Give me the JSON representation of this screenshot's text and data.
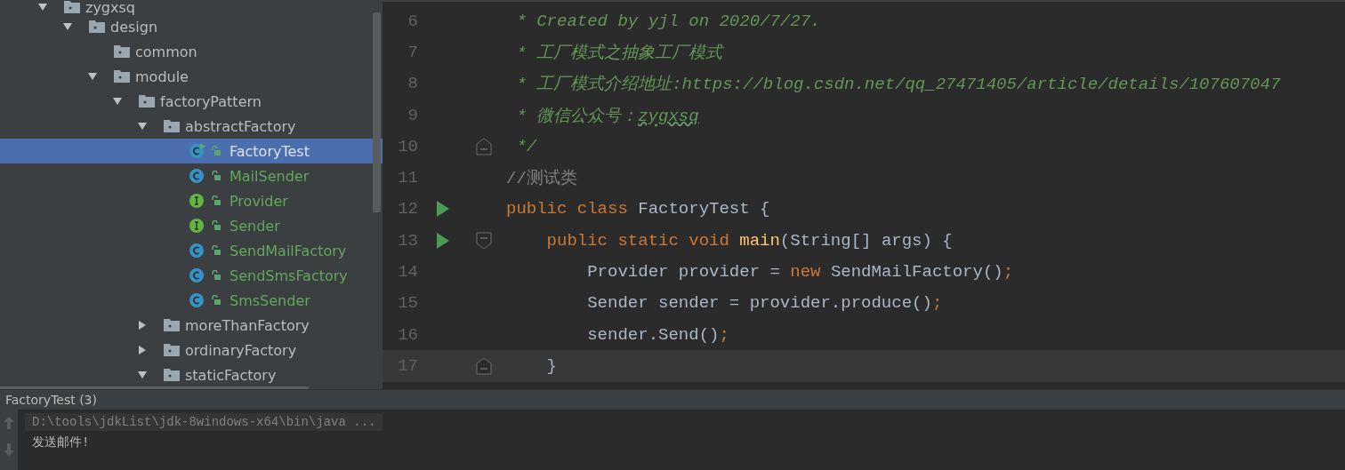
{
  "project_tree": [
    {
      "label": "zygxsq",
      "kind": "folder",
      "expanded": true,
      "selected": false,
      "children": [
        {
          "label": "design",
          "kind": "folder",
          "expanded": true,
          "selected": false,
          "children": [
            {
              "label": "common",
              "kind": "folder",
              "selected": false
            },
            {
              "label": "module",
              "kind": "folder",
              "expanded": true,
              "selected": false,
              "children": [
                {
                  "label": "factoryPattern",
                  "kind": "folder",
                  "expanded": true,
                  "selected": false,
                  "children": [
                    {
                      "label": "abstractFactory",
                      "kind": "folder",
                      "expanded": true,
                      "selected": false,
                      "children": [
                        {
                          "label": "FactoryTest",
                          "kind": "runnable_class",
                          "selected": true
                        },
                        {
                          "label": "MailSender",
                          "kind": "class",
                          "selected": false
                        },
                        {
                          "label": "Provider",
                          "kind": "interface",
                          "selected": false
                        },
                        {
                          "label": "Sender",
                          "kind": "interface",
                          "selected": false
                        },
                        {
                          "label": "SendMailFactory",
                          "kind": "class",
                          "selected": false
                        },
                        {
                          "label": "SendSmsFactory",
                          "kind": "class",
                          "selected": false
                        },
                        {
                          "label": "SmsSender",
                          "kind": "class",
                          "selected": false
                        }
                      ]
                    },
                    {
                      "label": "moreThanFactory",
                      "kind": "folder",
                      "expanded": false,
                      "selected": false
                    },
                    {
                      "label": "ordinaryFactory",
                      "kind": "folder",
                      "expanded": false,
                      "selected": false
                    },
                    {
                      "label": "staticFactory",
                      "kind": "folder",
                      "expanded": true,
                      "selected": false
                    }
                  ]
                }
              ]
            }
          ]
        }
      ]
    }
  ],
  "editor": {
    "lines": [
      {
        "number": "6",
        "tokens": [
          {
            "kind": "comment",
            "text": " * Created by yjl on 2020/7/27."
          }
        ]
      },
      {
        "number": "7",
        "tokens": [
          {
            "kind": "comment",
            "text": " * 工厂模式之抽象工厂模式"
          }
        ]
      },
      {
        "number": "8",
        "tokens": [
          {
            "kind": "comment",
            "text": " * 工厂模式介绍地址:https://blog.csdn.net/qq_27471405/article/details/107607047"
          }
        ]
      },
      {
        "number": "9",
        "tokens": [
          {
            "kind": "comment",
            "text": " * 微信公众号："
          },
          {
            "kind": "comment_typo",
            "text": "zygxsq"
          }
        ]
      },
      {
        "number": "10",
        "fold_end": true,
        "tokens": [
          {
            "kind": "comment",
            "text": " */"
          }
        ]
      },
      {
        "number": "11",
        "tokens": [
          {
            "kind": "line_comment",
            "text": "//测试类"
          }
        ]
      },
      {
        "number": "12",
        "run_marker": true,
        "tokens": [
          {
            "kind": "keyword",
            "text": "public class "
          },
          {
            "kind": "plain",
            "text": "FactoryTest {"
          }
        ]
      },
      {
        "number": "13",
        "run_marker": true,
        "fold_start": true,
        "tokens": [
          {
            "kind": "keyword",
            "text": "    public static void "
          },
          {
            "kind": "method",
            "text": "main"
          },
          {
            "kind": "plain",
            "text": "(String[] args) {"
          }
        ]
      },
      {
        "number": "14",
        "tokens": [
          {
            "kind": "plain",
            "text": "        Provider provider = "
          },
          {
            "kind": "keyword",
            "text": "new "
          },
          {
            "kind": "plain",
            "text": "SendMailFactory()"
          },
          {
            "kind": "keyword",
            "text": ";"
          }
        ]
      },
      {
        "number": "15",
        "tokens": [
          {
            "kind": "plain",
            "text": "        Sender sender = provider.produce()"
          },
          {
            "kind": "keyword",
            "text": ";"
          }
        ]
      },
      {
        "number": "16",
        "tokens": [
          {
            "kind": "plain",
            "text": "        sender.Send()"
          },
          {
            "kind": "keyword",
            "text": ";"
          }
        ]
      },
      {
        "number": "17",
        "current": true,
        "fold_end": true,
        "tokens": [
          {
            "kind": "plain",
            "text": "    }"
          }
        ]
      }
    ]
  },
  "run_panel": {
    "tab_title": "FactoryTest (3)",
    "console": [
      {
        "kind": "command",
        "text": "D:\\tools\\jdkList\\jdk-8windows-x64\\bin\\java ..."
      },
      {
        "kind": "output",
        "text": "发送邮件!"
      }
    ]
  }
}
